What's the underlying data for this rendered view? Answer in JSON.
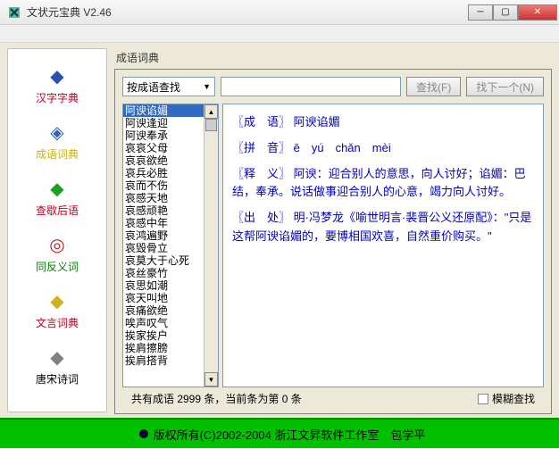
{
  "window": {
    "title": "文状元宝典 V2.46"
  },
  "sidebar": {
    "items": [
      {
        "label": "汉字字典",
        "color": "#c00020",
        "glyph": "◆",
        "iconColor": "#2a4fb0"
      },
      {
        "label": "成语词典",
        "color": "#d0b000",
        "glyph": "◈",
        "iconColor": "#3060c0"
      },
      {
        "label": "查歇后语",
        "color": "#c00020",
        "glyph": "◆",
        "iconColor": "#20a020"
      },
      {
        "label": "同反义词",
        "color": "#008000",
        "glyph": "◎",
        "iconColor": "#c02020"
      },
      {
        "label": "文言词典",
        "color": "#c00020",
        "glyph": "◆",
        "iconColor": "#d0b020"
      },
      {
        "label": "唐宋诗词",
        "color": "#000000",
        "glyph": "◆",
        "iconColor": "#808080"
      }
    ]
  },
  "panel": {
    "title": "成语词典",
    "combo_label": "按成语查找",
    "search_btn": "查找(F)",
    "next_btn": "找下一个(N)",
    "list": [
      "阿谀谄媚",
      "阿谀逢迎",
      "阿谀奉承",
      "哀哀父母",
      "哀哀欲绝",
      "哀兵必胜",
      "哀而不伤",
      "哀感天地",
      "哀感顽艳",
      "哀感中年",
      "哀鸿遍野",
      "哀毁骨立",
      "哀莫大于心死",
      "哀丝豪竹",
      "哀思如潮",
      "哀天叫地",
      "哀痛欲绝",
      "唉声叹气",
      "挨家挨户",
      "挨肩擦膀",
      "挨肩搭背"
    ],
    "selected_index": 0,
    "def": {
      "l1": "〖成　语〗 阿谀谄媚",
      "l2": "〖拼　音〗 ē　yú　chǎn　mèi",
      "l3": "〖释　义〗 阿谀：迎合别人的意思，向人讨好；谄媚：巴结，奉承。说话做事迎合别人的心意，竭力向人讨好。",
      "l4": "〖出　处〗 明·冯梦龙《喻世明言·裴晋公义还原配》：\"只是这帮阿谀谄媚的，要博相国欢喜，自然重价购买。\""
    },
    "status": "共有成语 2999 条，当前条为第 0 条",
    "checkbox": "模糊查找"
  },
  "footer": {
    "text": "版权所有(C)2002-2004 浙江文昇软件工作室　包学平"
  }
}
